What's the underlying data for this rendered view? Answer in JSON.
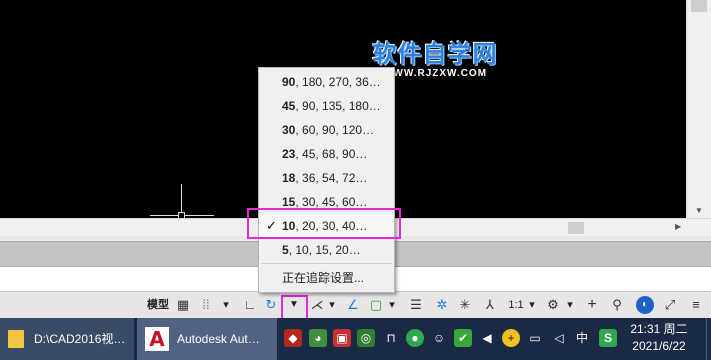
{
  "watermark": {
    "title": "软件自学网",
    "url": "WWW.RJZXW.COM"
  },
  "snap_menu": {
    "items": [
      {
        "first": "90",
        "rest": ", 180, 270, 36…",
        "checked": false
      },
      {
        "first": "45",
        "rest": ", 90, 135, 180…",
        "checked": false
      },
      {
        "first": "30",
        "rest": ", 60, 90, 120…",
        "checked": false
      },
      {
        "first": "23",
        "rest": ", 45, 68, 90…",
        "checked": false
      },
      {
        "first": "18",
        "rest": ", 36, 54, 72…",
        "checked": false
      },
      {
        "first": "15",
        "rest": ", 30, 45, 60…",
        "checked": false
      },
      {
        "first": "10",
        "rest": ", 20, 30, 40…",
        "checked": true
      },
      {
        "first": "5",
        "rest": ", 10, 15, 20…",
        "checked": false
      }
    ],
    "settings_label": "正在追踪设置...",
    "check_glyph": "✓"
  },
  "statusbar": {
    "model_label": "模型",
    "scale_label": "1:1",
    "icons": [
      "grid-icon",
      "snap-icon",
      "ortho-icon",
      "polar-tracking-icon",
      "dropdown-arrow-icon",
      "object-snap-tracking-icon",
      "lineweight-icon",
      "annotation-icon",
      "scale-icon",
      "workspace-gear-icon",
      "plus-icon",
      "isolate-icon",
      "hardware-accel-icon",
      "fullscreen-icon",
      "customize-icon"
    ],
    "arrow_glyph": "▾"
  },
  "taskbar": {
    "folder_title": "D:\\CAD2016视…",
    "autocad_title": "Autodesk Aut…",
    "ime_label": "中",
    "time": "21:31 周二",
    "date": "2021/6/22"
  },
  "colors": {
    "highlight": "#e22ad8",
    "canvas": "#000000",
    "taskbar": "#1a2a44",
    "watermark": "#2d7fe0"
  }
}
